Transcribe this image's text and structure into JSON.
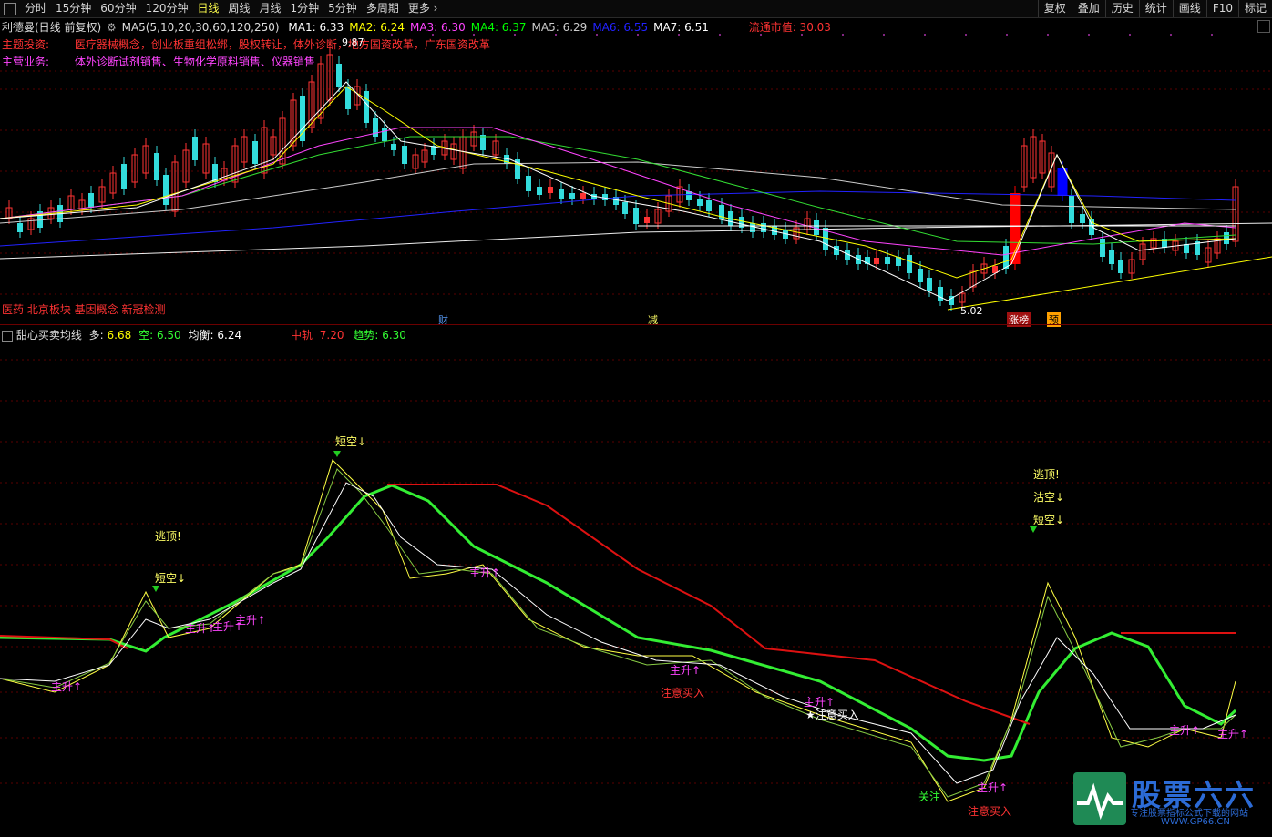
{
  "toolbar": {
    "tabs": [
      "分时",
      "15分钟",
      "60分钟",
      "120分钟",
      "日线",
      "周线",
      "月线",
      "1分钟",
      "5分钟",
      "多周期",
      "更多"
    ],
    "active_tab": "日线",
    "right_buttons": [
      "复权",
      "叠加",
      "历史",
      "统计",
      "画线",
      "F10",
      "标记"
    ]
  },
  "main_chart": {
    "stock_title": "利德曼(日线 前复权)",
    "ma_params": "MA5(5,10,20,30,60,120,250)",
    "ma_items": [
      {
        "label": "MA1: 6.33",
        "color": "#ffffff"
      },
      {
        "label": "MA2: 6.24",
        "color": "#ffff00"
      },
      {
        "label": "MA3: 6.30",
        "color": "#ff44ff"
      },
      {
        "label": "MA4: 6.37",
        "color": "#00ff00"
      },
      {
        "label": "MA5: 6.29",
        "color": "#cccccc"
      },
      {
        "label": "MA6: 6.55",
        "color": "#2222ff"
      },
      {
        "label": "MA7: 6.51",
        "color": "#ffffff"
      }
    ],
    "float_cap_label": "流通市值: 30.03",
    "theme_label": "主题投资:",
    "theme_text": "医疗器械概念，创业板重组松绑，股权转让，体外诊断，地方国资改革，广东国资改革",
    "business_label": "主营业务:",
    "business_text": "体外诊断试剂销售、生物化学原料销售、仪器销售",
    "tags": "医药 北京板块 基因概念 新冠检测",
    "high_price": "9.87",
    "low_price": "5.02",
    "markers": [
      "财",
      "减",
      "涨榜",
      "预"
    ]
  },
  "indicator_panel": {
    "name": "甜心买卖均线",
    "long_label": "多:",
    "long_value": "6.68",
    "short_label": "空:",
    "short_value": "6.50",
    "balance_label": "均衡:",
    "balance_value": "6.24",
    "mid_label": "中轨",
    "mid_value": "7.20",
    "trend_label": "趋势:",
    "trend_value": "6.30",
    "annotations": [
      {
        "text": "短空↓",
        "color": "#ffff66"
      },
      {
        "text": "逃顶!",
        "color": "#ffff66"
      },
      {
        "text": "短空↓",
        "color": "#ffff66"
      },
      {
        "text": "主升↑",
        "color": "#ff44ff"
      },
      {
        "text": "主升↑",
        "color": "#ff44ff"
      },
      {
        "text": "主升↑",
        "color": "#ff44ff"
      },
      {
        "text": "主升↑",
        "color": "#ff44ff"
      },
      {
        "text": "主升↑",
        "color": "#ff44ff"
      },
      {
        "text": "主升↑",
        "color": "#ff44ff"
      },
      {
        "text": "注意买入",
        "color": "#ff3333"
      },
      {
        "text": "主升↑",
        "color": "#ff44ff"
      },
      {
        "text": "★注意买入",
        "color": "#ffffff"
      },
      {
        "text": "关注",
        "color": "#33ff33"
      },
      {
        "text": "主升↑",
        "color": "#ff44ff"
      },
      {
        "text": "注意买入",
        "color": "#ff3333"
      },
      {
        "text": "逃顶!",
        "color": "#ffff66"
      },
      {
        "text": "沽空↓",
        "color": "#ffff66"
      },
      {
        "text": "短空↓",
        "color": "#ffff66"
      },
      {
        "text": "主升↑",
        "color": "#ff44ff"
      },
      {
        "text": "主升↑",
        "color": "#ff44ff"
      }
    ]
  },
  "logo": {
    "name": "股票六六",
    "slogan": "专注股票指标公式下载的网站",
    "url": "WWW.GP66.CN"
  },
  "colors": {
    "up": "#ff3333",
    "down": "#33dddd",
    "separator": "#6b0000"
  }
}
